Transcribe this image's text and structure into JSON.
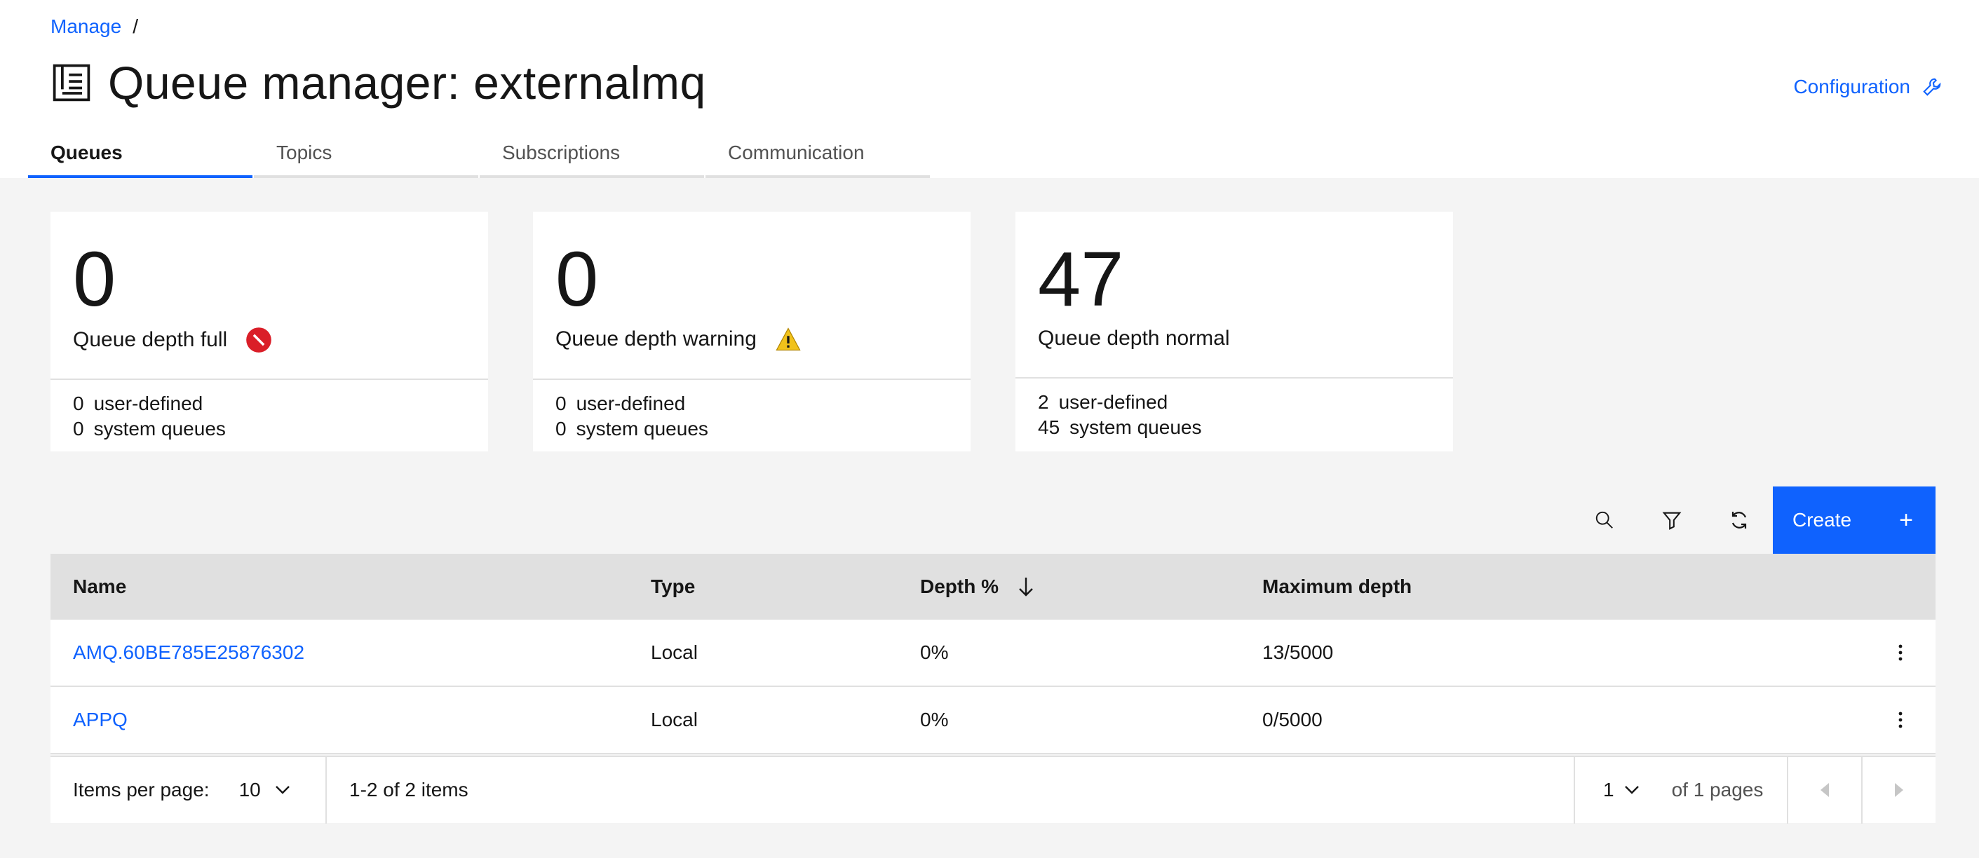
{
  "breadcrumb": {
    "link": "Manage",
    "separator": "/"
  },
  "page": {
    "title": "Queue manager: externalmq",
    "config_link": "Configuration"
  },
  "tabs": [
    {
      "label": "Queues",
      "active": true
    },
    {
      "label": "Topics",
      "active": false
    },
    {
      "label": "Subscriptions",
      "active": false
    },
    {
      "label": "Communication",
      "active": false
    }
  ],
  "tiles": [
    {
      "count": "0",
      "label": "Queue depth full",
      "icon": "error-icon",
      "user_defined_count": "0",
      "user_defined_label": "user-defined",
      "system_count": "0",
      "system_label": "system queues"
    },
    {
      "count": "0",
      "label": "Queue depth warning",
      "icon": "warning-icon",
      "user_defined_count": "0",
      "user_defined_label": "user-defined",
      "system_count": "0",
      "system_label": "system queues"
    },
    {
      "count": "47",
      "label": "Queue depth normal",
      "icon": "",
      "user_defined_count": "2",
      "user_defined_label": "user-defined",
      "system_count": "45",
      "system_label": "system queues"
    }
  ],
  "toolbar": {
    "create_label": "Create",
    "create_icon": "+"
  },
  "table": {
    "headers": {
      "name": "Name",
      "type": "Type",
      "depth": "Depth %",
      "max_depth": "Maximum depth"
    },
    "rows": [
      {
        "name": "AMQ.60BE785E25876302",
        "type": "Local",
        "depth": "0%",
        "max_depth": "13/5000"
      },
      {
        "name": "APPQ",
        "type": "Local",
        "depth": "0%",
        "max_depth": "0/5000"
      }
    ]
  },
  "pagination": {
    "items_per_page_label": "Items per page:",
    "items_per_page": "10",
    "range": "1-2 of 2 items",
    "page": "1",
    "of_pages": "of 1 pages"
  },
  "colors": {
    "accent": "#0f62fe",
    "error": "#da1e28",
    "warning": "#f1c21b",
    "background": "#f4f4f4"
  }
}
